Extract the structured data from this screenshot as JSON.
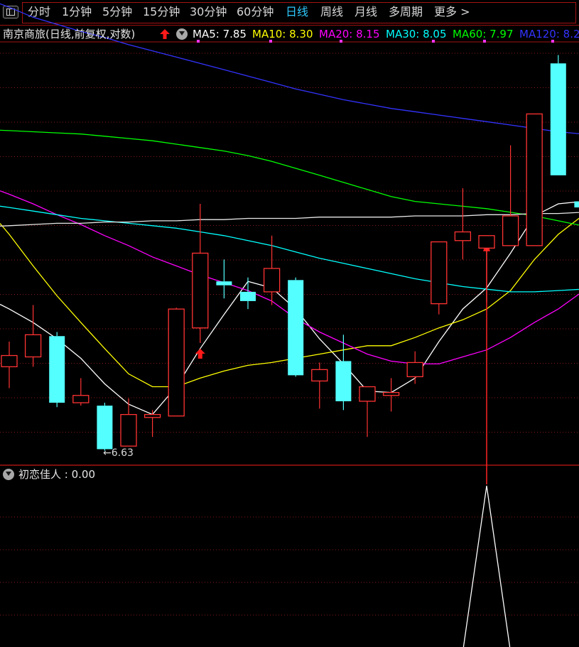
{
  "tabs": [
    {
      "label": "分时",
      "active": false
    },
    {
      "label": "1分钟",
      "active": false
    },
    {
      "label": "5分钟",
      "active": false
    },
    {
      "label": "15分钟",
      "active": false
    },
    {
      "label": "30分钟",
      "active": false
    },
    {
      "label": "60分钟",
      "active": false
    },
    {
      "label": "日线",
      "active": true
    },
    {
      "label": "周线",
      "active": false
    },
    {
      "label": "月线",
      "active": false
    },
    {
      "label": "多周期",
      "active": false
    },
    {
      "label": "更多 >",
      "active": false
    }
  ],
  "stock_title": "南京商旅(日线,前复权,对数)",
  "ma_labels": [
    {
      "text": "MA5: 7.85",
      "color": "#ffffff"
    },
    {
      "text": "MA10: 8.30",
      "color": "#ffff00"
    },
    {
      "text": "MA20: 8.15",
      "color": "#ff00ff"
    },
    {
      "text": "MA30: 8.05",
      "color": "#00ffff"
    },
    {
      "text": "MA60: 7.97",
      "color": "#00ff00"
    },
    {
      "text": "MA120: 8.2",
      "color": "#3333ff"
    }
  ],
  "indicator_label": "初恋佳人 : 0.00",
  "low_label": "←6.63",
  "colors": {
    "up": "#ff3333",
    "down": "#54ffff",
    "grid": "#8b1a1a",
    "separator": "#a51212",
    "signal_line": "#ff2222",
    "indicator_line": "#ffffff"
  },
  "chart_data": {
    "type": "candlestick",
    "scale": "log",
    "ylim": [
      6.55,
      9.9
    ],
    "candles": [
      {
        "open": 7.2,
        "close": 7.28,
        "high": 7.38,
        "low": 7.05
      },
      {
        "open": 7.27,
        "close": 7.43,
        "high": 7.65,
        "low": 7.2
      },
      {
        "open": 7.42,
        "close": 6.95,
        "high": 7.45,
        "low": 6.92
      },
      {
        "open": 6.95,
        "close": 7.0,
        "high": 7.12,
        "low": 6.93
      },
      {
        "open": 6.93,
        "close": 6.64,
        "high": 6.95,
        "low": 6.63
      },
      {
        "open": 6.66,
        "close": 6.87,
        "high": 6.98,
        "low": 6.66
      },
      {
        "open": 6.85,
        "close": 6.87,
        "high": 6.9,
        "low": 6.72
      },
      {
        "open": 6.86,
        "close": 7.62,
        "high": 7.63,
        "low": 6.86
      },
      {
        "open": 7.48,
        "close": 8.05,
        "high": 8.45,
        "low": 7.37
      },
      {
        "open": 7.83,
        "close": 7.8,
        "high": 8.0,
        "low": 7.7
      },
      {
        "open": 7.75,
        "close": 7.68,
        "high": 7.86,
        "low": 7.62
      },
      {
        "open": 7.75,
        "close": 7.93,
        "high": 8.19,
        "low": 7.65
      },
      {
        "open": 7.84,
        "close": 7.14,
        "high": 7.86,
        "low": 7.13
      },
      {
        "open": 7.1,
        "close": 7.18,
        "high": 7.23,
        "low": 6.91
      },
      {
        "open": 7.24,
        "close": 6.96,
        "high": 7.43,
        "low": 6.9
      },
      {
        "open": 6.96,
        "close": 7.06,
        "high": 7.06,
        "low": 6.72
      },
      {
        "open": 7.0,
        "close": 7.02,
        "high": 7.12,
        "low": 6.89
      },
      {
        "open": 7.13,
        "close": 7.23,
        "high": 7.31,
        "low": 7.08
      },
      {
        "open": 7.66,
        "close": 8.14,
        "high": 8.14,
        "low": 7.58
      },
      {
        "open": 8.15,
        "close": 8.22,
        "high": 8.58,
        "low": 8.0
      },
      {
        "open": 8.09,
        "close": 8.19,
        "high": 8.19,
        "low": 7.67
      },
      {
        "open": 8.11,
        "close": 8.35,
        "high": 8.95,
        "low": 8.11
      },
      {
        "open": 8.11,
        "close": 9.23,
        "high": 9.23,
        "low": 8.11
      },
      {
        "open": 9.7,
        "close": 8.69,
        "high": 9.78,
        "low": 8.69
      },
      {
        "open": 8.47,
        "close": 8.42,
        "high": 8.53,
        "low": 8.35
      }
    ],
    "signal_candle_index": 20,
    "series": [
      {
        "name": "MA5",
        "color": "#ffffff",
        "values": [
          7.62,
          7.52,
          7.4,
          7.26,
          7.08,
          6.94,
          6.87,
          7.06,
          7.33,
          7.58,
          7.83,
          7.78,
          7.62,
          7.4,
          7.22,
          7.03,
          7.02,
          7.12,
          7.38,
          7.62,
          7.78,
          8.05,
          8.35,
          8.45,
          8.47
        ]
      },
      {
        "name": "MA10",
        "color": "#ffff00",
        "values": [
          8.2,
          7.95,
          7.72,
          7.52,
          7.33,
          7.15,
          7.06,
          7.06,
          7.12,
          7.17,
          7.21,
          7.23,
          7.26,
          7.29,
          7.32,
          7.35,
          7.35,
          7.41,
          7.48,
          7.54,
          7.62,
          7.76,
          8.0,
          8.2,
          8.35
        ]
      },
      {
        "name": "MA20",
        "color": "#ff00ff",
        "values": [
          8.53,
          8.45,
          8.36,
          8.28,
          8.19,
          8.11,
          8.02,
          7.95,
          7.88,
          7.82,
          7.76,
          7.68,
          7.55,
          7.45,
          7.37,
          7.29,
          7.24,
          7.22,
          7.22,
          7.27,
          7.32,
          7.41,
          7.52,
          7.62,
          7.75
        ]
      },
      {
        "name": "MA30",
        "color": "#00ffff",
        "values": [
          8.42,
          8.39,
          8.36,
          8.33,
          8.31,
          8.29,
          8.27,
          8.25,
          8.22,
          8.19,
          8.15,
          8.11,
          8.06,
          8.01,
          7.97,
          7.93,
          7.89,
          7.85,
          7.82,
          7.79,
          7.77,
          7.75,
          7.75,
          7.76,
          7.77
        ]
      },
      {
        "name": "MA60",
        "color": "#00ff00",
        "values": [
          9.08,
          9.07,
          9.06,
          9.05,
          9.03,
          9.01,
          8.99,
          8.96,
          8.93,
          8.9,
          8.86,
          8.81,
          8.75,
          8.69,
          8.63,
          8.57,
          8.51,
          8.47,
          8.45,
          8.43,
          8.41,
          8.38,
          8.35,
          8.31,
          8.27
        ]
      },
      {
        "name": "MA120",
        "color": "#3333ff",
        "values": [
          10.25,
          10.15,
          10.08,
          10.01,
          9.95,
          9.88,
          9.82,
          9.76,
          9.7,
          9.64,
          9.58,
          9.52,
          9.46,
          9.41,
          9.36,
          9.32,
          9.28,
          9.25,
          9.22,
          9.19,
          9.16,
          9.13,
          9.1,
          9.07,
          9.05
        ]
      },
      {
        "name": "MA250",
        "color": "#e8e8e8",
        "values": [
          8.27,
          8.28,
          8.29,
          8.29,
          8.3,
          8.3,
          8.31,
          8.31,
          8.32,
          8.32,
          8.33,
          8.33,
          8.33,
          8.34,
          8.34,
          8.34,
          8.34,
          8.35,
          8.35,
          8.35,
          8.36,
          8.36,
          8.37,
          8.37,
          8.38
        ]
      }
    ],
    "indicator": {
      "name": "初恋佳人",
      "current": 0.0,
      "values": [
        0,
        0,
        0,
        0,
        0,
        0,
        0,
        0,
        0,
        0,
        0,
        0,
        0,
        0,
        0,
        0,
        0,
        0,
        0,
        0,
        1,
        0,
        0,
        0,
        0
      ]
    }
  }
}
